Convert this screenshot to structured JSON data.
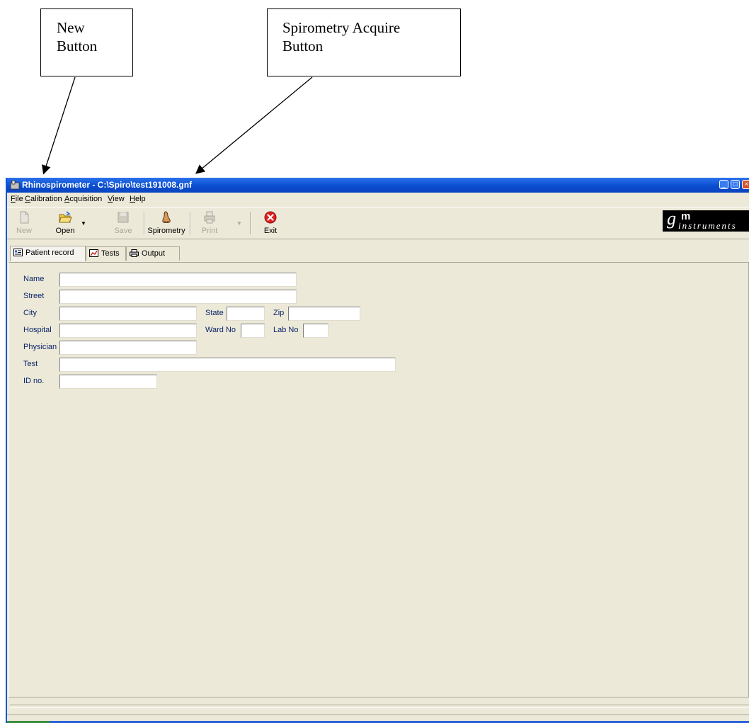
{
  "annotations": {
    "new_callout": [
      "New",
      "Button"
    ],
    "spiro_callout": [
      "Spirometry Acquire",
      "Button"
    ]
  },
  "window": {
    "title": "Rhinospirometer - C:\\Spiro\\test191008.gnf",
    "controls": [
      "minimize",
      "maximize",
      "close"
    ]
  },
  "menu": [
    "File",
    "Calibration",
    "Acquisition",
    "View",
    "Help"
  ],
  "toolbar": {
    "new_label": "New",
    "open_label": "Open",
    "save_label": "Save",
    "spirometry_label": "Spirometry",
    "print_label": "Print",
    "exit_label": "Exit"
  },
  "logo": {
    "letters": "gm",
    "sub": "instruments"
  },
  "tabs": [
    {
      "label": "Patient record",
      "icon": "card-icon",
      "active": true
    },
    {
      "label": "Tests",
      "icon": "chart-icon",
      "active": false
    },
    {
      "label": "Output",
      "icon": "printer-icon",
      "active": false
    }
  ],
  "form": {
    "name_label": "Name",
    "street_label": "Street",
    "city_label": "City",
    "state_label": "State",
    "zip_label": "Zip",
    "hospital_label": "Hospital",
    "ward_label": "Ward No",
    "lab_label": "Lab No",
    "physician_label": "Physician",
    "test_label": "Test",
    "id_label": "ID no.",
    "values": {
      "name": "",
      "street": "",
      "city": "",
      "state": "",
      "zip": "",
      "hospital": "",
      "ward": "",
      "lab": "",
      "physician": "",
      "test": "",
      "id": ""
    }
  },
  "colors": {
    "titlebar": "#0a4ed0",
    "window_bg": "#ece9d8",
    "label_text": "#0a246a",
    "close_button": "#d8502a"
  }
}
